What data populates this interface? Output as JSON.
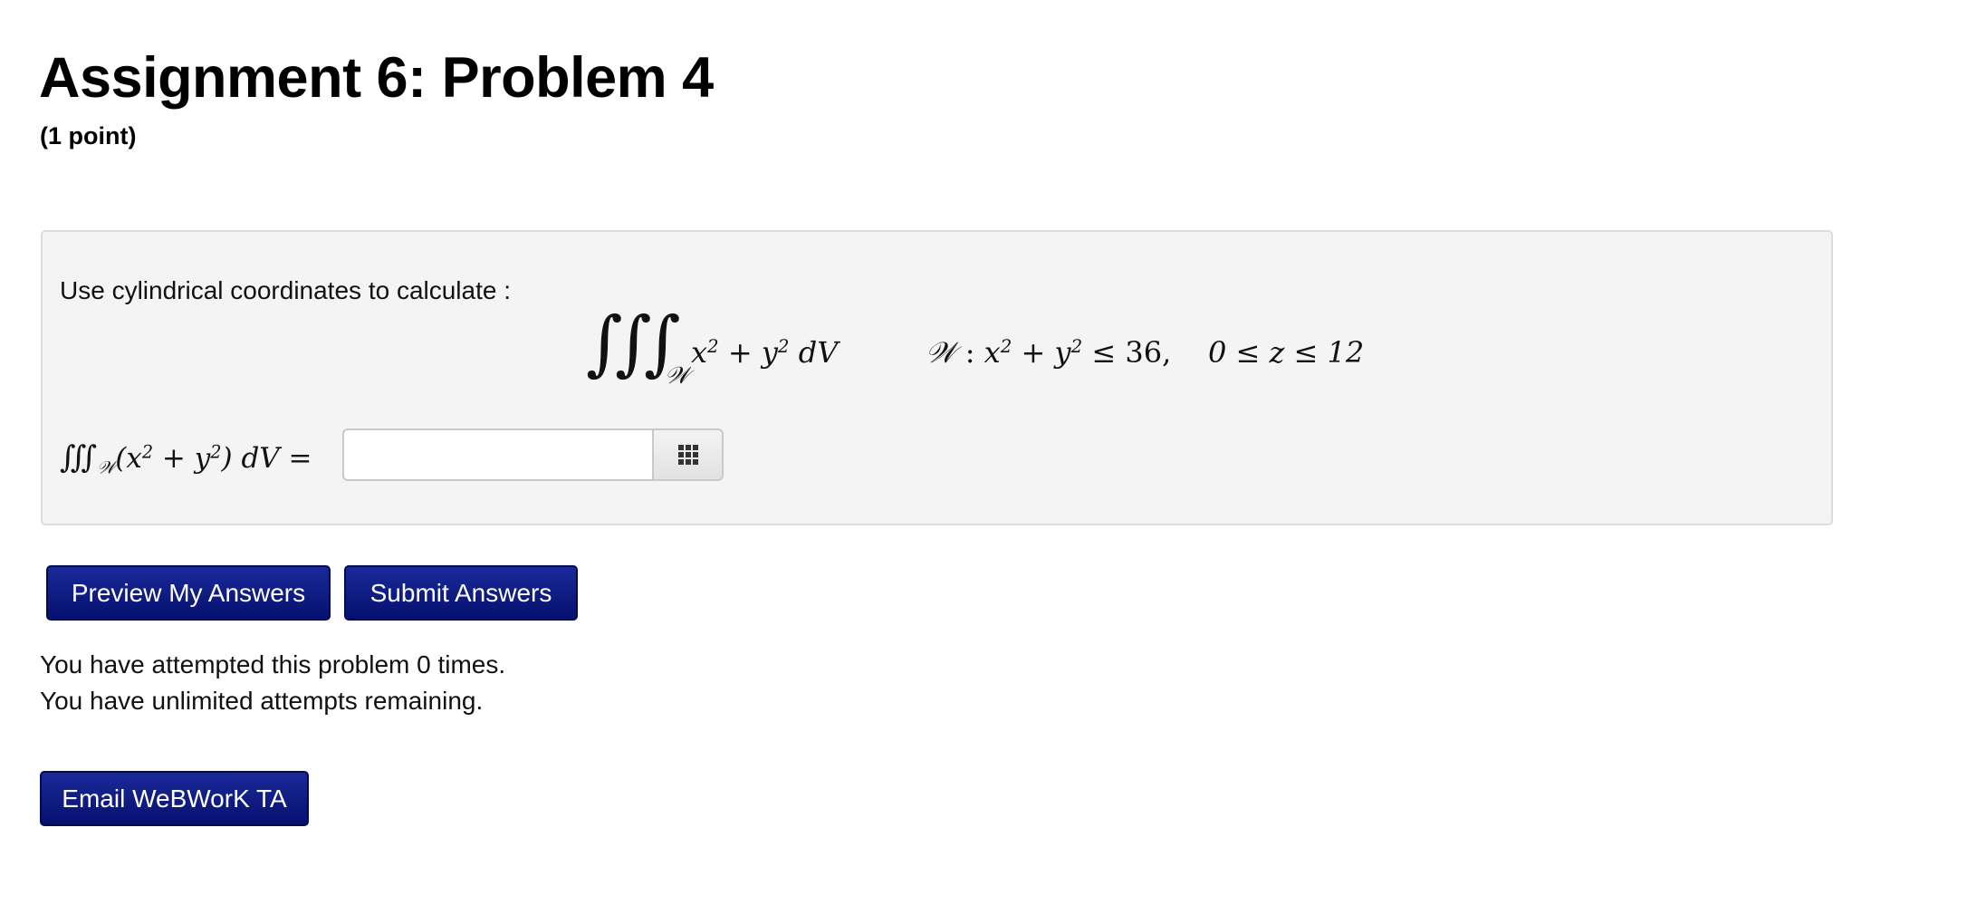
{
  "header": {
    "title": "Assignment 6: Problem 4",
    "points": "(1 point)"
  },
  "problem": {
    "instructions": "Use cylindrical coordinates to calculate :",
    "equation": {
      "integral_subscript": "𝒲",
      "integrand_x": "x",
      "integrand_plus": " + ",
      "integrand_y": "y",
      "integrand_dv": " dV",
      "exponent": "2",
      "region_name": "𝒲",
      "region_colon": " : ",
      "region_ineq": " ≤ 36,",
      "z_range": "0 ≤ z ≤ 12"
    },
    "answer": {
      "label_lhs": "(x",
      "label_mid": " + y",
      "label_rhs": ") dV =",
      "value": "",
      "placeholder": ""
    }
  },
  "buttons": {
    "preview": "Preview My Answers",
    "submit": "Submit Answers",
    "email": "Email WeBWorK TA"
  },
  "status": {
    "attempts_made": "You have attempted this problem 0 times.",
    "attempts_remaining": "You have unlimited attempts remaining."
  },
  "icons": {
    "answer_palette": "grid-icon"
  },
  "colors": {
    "button_bg": "#0a1578",
    "problem_bg": "#f4f4f4",
    "problem_border": "#dcdcdc"
  }
}
